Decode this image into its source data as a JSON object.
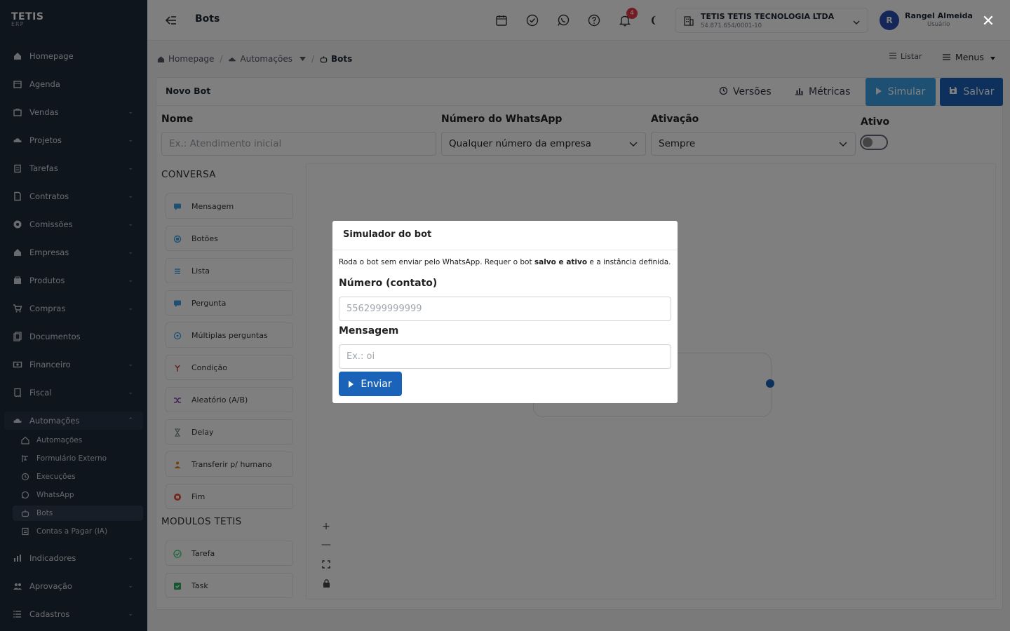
{
  "brand": {
    "name": "TETIS",
    "sub": "ERP"
  },
  "sidebar": {
    "items": [
      {
        "label": "Homepage",
        "icon": "home-icon",
        "chevron": false
      },
      {
        "label": "Agenda",
        "icon": "calendar-icon",
        "chevron": false
      },
      {
        "label": "Vendas",
        "icon": "bag-icon",
        "chevron": true
      },
      {
        "label": "Projetos",
        "icon": "cloud-icon",
        "chevron": true
      },
      {
        "label": "Tarefas",
        "icon": "clipboard-icon",
        "chevron": true
      },
      {
        "label": "Contratos",
        "icon": "file-icon",
        "chevron": true
      },
      {
        "label": "Comissões",
        "icon": "badge-icon",
        "chevron": true
      },
      {
        "label": "Empresas",
        "icon": "home-icon",
        "chevron": true
      },
      {
        "label": "Produtos",
        "icon": "package-icon",
        "chevron": true
      },
      {
        "label": "Compras",
        "icon": "cart-icon",
        "chevron": true
      },
      {
        "label": "Documentos",
        "icon": "document-icon",
        "chevron": false
      },
      {
        "label": "Financeiro",
        "icon": "money-icon",
        "chevron": true
      },
      {
        "label": "Fiscal",
        "icon": "receipt-icon",
        "chevron": true
      },
      {
        "label": "Automações",
        "icon": "cloud-icon",
        "chevron": true
      }
    ],
    "sub_items": [
      {
        "label": "Automações",
        "icon": "home-icon"
      },
      {
        "label": "Formulário Externo",
        "icon": "form-icon"
      },
      {
        "label": "Execuções",
        "icon": "history-icon"
      },
      {
        "label": "WhatsApp",
        "icon": "whatsapp-icon"
      },
      {
        "label": "Bots",
        "icon": "bot-icon"
      },
      {
        "label": "Contas a Pagar (IA)",
        "icon": "invoice-icon"
      }
    ],
    "bottom_items": [
      {
        "label": "Indicadores",
        "icon": "chart-icon",
        "chevron": true
      },
      {
        "label": "Aprovação",
        "icon": "users-icon",
        "chevron": true
      },
      {
        "label": "Cadastros",
        "icon": "list-icon",
        "chevron": true
      }
    ]
  },
  "topbar": {
    "title": "Bots",
    "notification_count": "4",
    "company_name": "TETIS TETIS TECNOLOGIA LTDA",
    "company_cnpj": "54.871.654/0001-10",
    "user_initial": "R",
    "user_name": "Rangel Almeida",
    "user_role": "Usuário"
  },
  "breadcrumb": {
    "home": "Homepage",
    "section": "Automações",
    "current": "Bots",
    "list_label": "Listar",
    "menus_label": "Menus"
  },
  "editor": {
    "title": "Novo Bot",
    "versions_label": "Versões",
    "metrics_label": "Métricas",
    "simulate_label": "Simular",
    "save_label": "Salvar",
    "fields": {
      "name_label": "Nome",
      "name_placeholder": "Ex.: Atendimento inicial",
      "whatsapp_label": "Número do WhatsApp",
      "whatsapp_value": "Qualquer número da empresa",
      "activation_label": "Ativação",
      "activation_value": "Sempre",
      "active_label": "Ativo"
    },
    "section_conversa": "CONVERSA",
    "conversa_items": [
      {
        "label": "Mensagem",
        "icon": "message-icon",
        "color": "#3aa0e6"
      },
      {
        "label": "Botões",
        "icon": "buttons-icon",
        "color": "#3aa0e6"
      },
      {
        "label": "Lista",
        "icon": "list-icon",
        "color": "#3aa0e6"
      },
      {
        "label": "Pergunta",
        "icon": "question-icon",
        "color": "#3aa0e6"
      },
      {
        "label": "Múltiplas perguntas",
        "icon": "multi-question-icon",
        "color": "#3aa0e6"
      },
      {
        "label": "Condição",
        "icon": "condition-icon",
        "color": "#c0392b"
      },
      {
        "label": "Aleatório (A/B)",
        "icon": "shuffle-icon",
        "color": "#8e44ad"
      },
      {
        "label": "Delay",
        "icon": "hourglass-icon",
        "color": "#7f8c8d"
      },
      {
        "label": "Transferir p/ humano",
        "icon": "person-icon",
        "color": "#e67e22"
      },
      {
        "label": "Fim",
        "icon": "stop-icon",
        "color": "#e74c3c"
      }
    ],
    "section_modulos": "MODULOS TETIS",
    "modulos_items": [
      {
        "label": "Tarefa",
        "icon": "check-circle-icon",
        "color": "#2ecc71"
      },
      {
        "label": "Task",
        "icon": "check-square-icon",
        "color": "#27ae60"
      }
    ]
  },
  "modal": {
    "title": "Simulador do bot",
    "desc_prefix": "Roda o bot sem enviar pelo WhatsApp. Requer o bot ",
    "desc_bold": "salvo e ativo",
    "desc_suffix": " e a instância definida.",
    "number_label": "Número (contato)",
    "number_placeholder": "5562999999999",
    "message_label": "Mensagem",
    "message_placeholder": "Ex.: oi",
    "send_label": "Enviar",
    "close_symbol": "✕"
  }
}
